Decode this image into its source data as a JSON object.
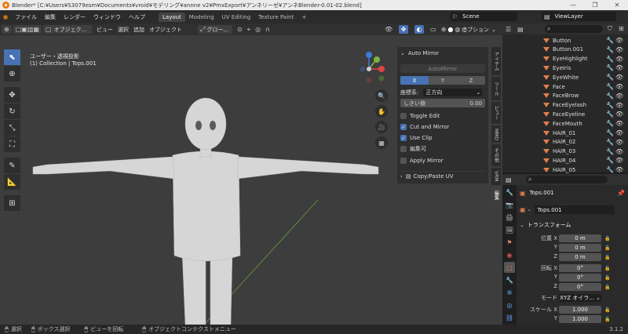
{
  "window": {
    "title": "Blender* [C:¥Users¥S3079esm¥Documents¥vroid¥モデリング¥annne v2¥PmxExport¥アンネリーゼ¥アンネBlender-0.01-02.blend]",
    "minimize": "—",
    "maximize": "❐",
    "close": "✕"
  },
  "menu": [
    "ファイル",
    "編集",
    "レンダー",
    "ウィンドウ",
    "ヘルプ"
  ],
  "workspaces": [
    "Layout",
    "Modeling",
    "UV Editing",
    "Texture Paint",
    "+"
  ],
  "scene": "Scene",
  "viewlayer": "ViewLayer",
  "viewport_header": {
    "mode": "オブジェク...",
    "view": "ビュー",
    "select": "選択",
    "add": "追加",
    "object": "オブジェクト",
    "transform": "グロー...",
    "options": "オプション"
  },
  "overlay_text": {
    "view_name": "ユーザー・透視投影",
    "collection": "(1) Collection | Tops.001"
  },
  "gizmo": {
    "x": "X",
    "y": "Y",
    "z": "Z"
  },
  "npanel": {
    "title": "Auto Mirror",
    "button": "AutoMirror",
    "axes": [
      "X",
      "Y",
      "Z"
    ],
    "orientation_label": "座標系:",
    "orientation_value": "正方向",
    "threshold_label": "しきい値",
    "threshold_value": "0.00",
    "toggle_edit": "Toggle Edit",
    "cut_mirror": "Cut and Mirror",
    "use_clip": "Use Clip",
    "editable": "編集可",
    "apply_mirror": "Apply Mirror",
    "copy_paste": "Copy/Paste UV"
  },
  "npanel_tabs": [
    "アイテム",
    "ツール",
    "ビュー",
    "MMD",
    "その他",
    "VRM",
    "編集"
  ],
  "outliner": [
    {
      "name": "Button",
      "icon": "tri"
    },
    {
      "name": "Button.001",
      "icon": "tri"
    },
    {
      "name": "EyeHighlight",
      "icon": "tri"
    },
    {
      "name": "EyeIris",
      "icon": "tri"
    },
    {
      "name": "EyeWhite",
      "icon": "tri"
    },
    {
      "name": "Face",
      "icon": "tri"
    },
    {
      "name": "FaceBrow",
      "icon": "tri"
    },
    {
      "name": "FaceEyelash",
      "icon": "tri"
    },
    {
      "name": "FaceEyeline",
      "icon": "tri"
    },
    {
      "name": "FaceMouth",
      "icon": "tri"
    },
    {
      "name": "HAIR_01",
      "icon": "tri"
    },
    {
      "name": "HAIR_02",
      "icon": "tri"
    },
    {
      "name": "HAIR_03",
      "icon": "tri"
    },
    {
      "name": "HAIR_04",
      "icon": "tri"
    },
    {
      "name": "HAIR_05",
      "icon": "tri"
    }
  ],
  "properties": {
    "object_name": "Tops.001",
    "data_name": "Tops.001",
    "section": "トランスフォーム",
    "location_label": "位置 X",
    "loc_y_label": "Y",
    "loc_z_label": "Z",
    "location": [
      "0 m",
      "0 m",
      "0 m"
    ],
    "rotation_label": "回転 X",
    "rot_y_label": "Y",
    "rot_z_label": "Z",
    "rotation": [
      "0°",
      "0°",
      "0°"
    ],
    "mode_label": "モード",
    "mode_value": "XYZ オイラ...",
    "scale_label": "スケール X",
    "scale_y_label": "Y",
    "scale": [
      "1.000",
      "1.000"
    ]
  },
  "status": {
    "select": "選択",
    "box": "ボックス選択",
    "rotate": "ビューを回転",
    "context": "オブジェクトコンテクストメニュー",
    "version": "3.1.2"
  },
  "colors": {
    "accent": "#4772b3",
    "object": "#e0804b",
    "viewport": "#3d3d3d"
  }
}
